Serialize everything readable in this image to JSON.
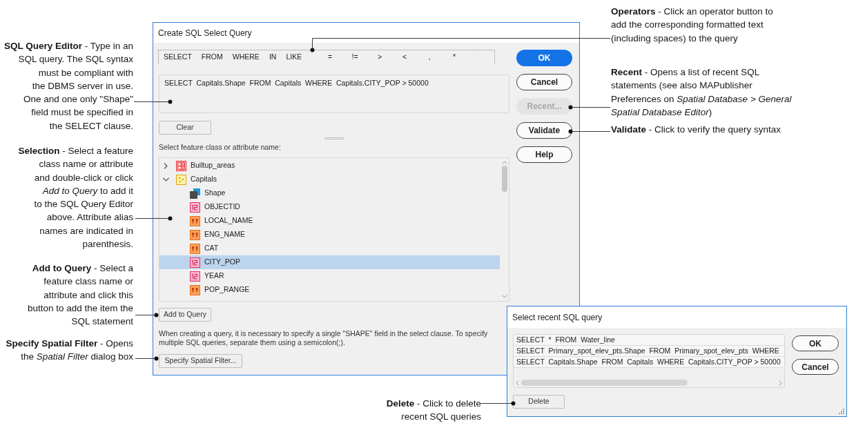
{
  "callouts": {
    "left": [
      "**SQL Query Editor** - Type in an\nSQL query. The SQL syntax\nmust be compliant with\nthe DBMS server in use.\nOne and one only \"Shape\"\nfield must be specified in\nthe SELECT clause.",
      "**Selection** - Select a feature\nclass name or attribute\nand double-click or click\n*Add to Query* to add it\nto the SQL Query Editor\nabove. Attribute alias\nnames are indicated in\nparenthesis.",
      "**Add to Query** - Select a\nfeature class name or\nattribute and click this\nbutton to add the item the\nSQL statement",
      "**Specify Spatial Filter** - Opens\nthe *Spatial Filter* dialog box"
    ],
    "right": [
      "**Operators** - Click an operator button to\nadd the corresponding formatted text\n(including spaces) to the query",
      "**Recent** - Opens a list of recent SQL\nstatements (see also MAPublisher\nPreferences on *Spatial Database > General*\n*Spatial Database Editor*)",
      "**Validate** - Click to verify the query syntax"
    ],
    "bottom": [
      "**Delete** - Click to delete\nrecent SQL queries"
    ]
  },
  "query_dialog": {
    "title": "Create SQL Select Query",
    "operators": [
      {
        "label": "SELECT",
        "kind": "keyword"
      },
      {
        "label": "FROM",
        "kind": "keyword"
      },
      {
        "label": "WHERE",
        "kind": "keyword"
      },
      {
        "label": "IN",
        "kind": "keyword"
      },
      {
        "label": "LIKE",
        "kind": "keyword"
      },
      {
        "label": "=",
        "kind": "symbol"
      },
      {
        "label": "!=",
        "kind": "symbol"
      },
      {
        "label": ">",
        "kind": "symbol"
      },
      {
        "label": "<",
        "kind": "symbol"
      },
      {
        "label": ",",
        "kind": "symbol"
      },
      {
        "label": "*",
        "kind": "symbol"
      }
    ],
    "editor": {
      "value": "SELECT  Capitals.Shape  FROM  Capitals  WHERE  Capitals.CITY_POP > 50000"
    },
    "clear_button": "Clear",
    "tree": {
      "label": "Select feature class or attribute name:",
      "items": [
        {
          "label": "Builtup_areas",
          "kind": "polygon_layer",
          "expanded": false,
          "selected": false
        },
        {
          "label": "Capitals",
          "kind": "point_layer",
          "expanded": true,
          "selected": false,
          "children": [
            {
              "label": "Shape",
              "kind": "geometry",
              "selected": false
            },
            {
              "label": "OBJECTID",
              "kind": "number",
              "selected": false
            },
            {
              "label": "LOCAL_NAME",
              "kind": "text",
              "selected": false
            },
            {
              "label": "ENG_NAME",
              "kind": "text",
              "selected": false
            },
            {
              "label": "CAT",
              "kind": "text",
              "selected": false
            },
            {
              "label": "CITY_POP",
              "kind": "number",
              "selected": true
            },
            {
              "label": "YEAR",
              "kind": "number",
              "selected": false
            },
            {
              "label": "POP_RANGE",
              "kind": "text",
              "selected": false
            }
          ]
        }
      ]
    },
    "add_button": "Add to Query",
    "hint": "When creating a query, it is necessary to specify a single \"SHAPE\" field in the select clause. To specify multiple SQL queries, separate them using a semicolon(;).",
    "spatial_filter_button": "Specify Spatial Filter...",
    "buttons": [
      {
        "label": "OK",
        "kind": "primary",
        "disabled": false
      },
      {
        "label": "Cancel",
        "kind": "default",
        "disabled": false
      },
      {
        "label": "Recent...",
        "kind": "default",
        "disabled": true
      },
      {
        "label": "Validate",
        "kind": "default",
        "disabled": false
      },
      {
        "label": "Help",
        "kind": "default",
        "disabled": false
      }
    ]
  },
  "recent_dialog": {
    "title": "Select recent SQL query",
    "queries": [
      {
        "text": "SELECT  *  FROM  Water_line",
        "selected": false
      },
      {
        "text": "SELECT  Primary_spot_elev_pts.Shape  FROM  Primary_spot_elev_pts  WHERE",
        "selected": false
      },
      {
        "text": "SELECT  Capitals.Shape  FROM  Capitals  WHERE  Capitals.CITY_POP > 50000",
        "selected": false
      }
    ],
    "delete_button": "Delete",
    "buttons": [
      {
        "label": "OK",
        "kind": "default",
        "disabled": false
      },
      {
        "label": "Cancel",
        "kind": "default",
        "disabled": false
      }
    ]
  }
}
